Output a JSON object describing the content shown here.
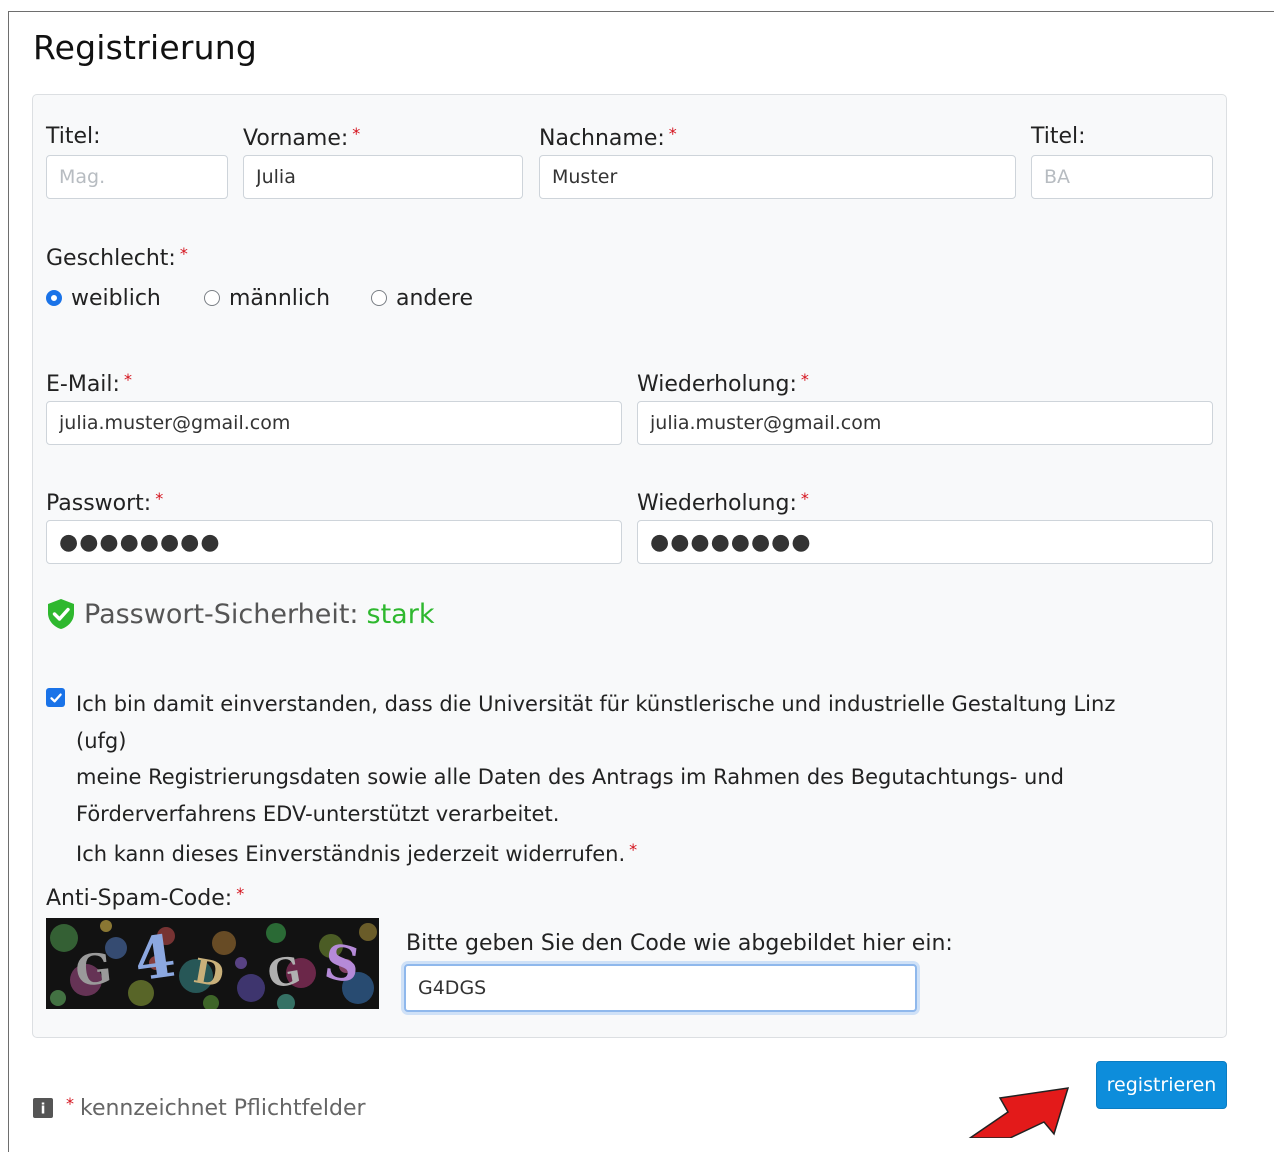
{
  "page": {
    "title": "Registrierung"
  },
  "required_mark": "*",
  "name_row": {
    "title_pre": {
      "label": "Titel:",
      "placeholder": "Mag."
    },
    "first_name": {
      "label": "Vorname:",
      "value": "Julia"
    },
    "last_name": {
      "label": "Nachname:",
      "value": "Muster"
    },
    "title_post": {
      "label": "Titel:",
      "placeholder": "BA"
    }
  },
  "gender": {
    "label": "Geschlecht:",
    "options": [
      "weiblich",
      "männlich",
      "andere"
    ],
    "selected": "weiblich"
  },
  "email": {
    "label": "E-Mail:",
    "value": "julia.muster@gmail.com",
    "repeat_label": "Wiederholung:",
    "repeat_value": "julia.muster@gmail.com"
  },
  "password": {
    "label": "Passwort:",
    "value": "●●●●●●●●",
    "repeat_label": "Wiederholung:",
    "repeat_value": "●●●●●●●●"
  },
  "strength": {
    "label": "Passwort-Sicherheit:",
    "value": "stark",
    "color": "#2eb82e"
  },
  "consent": {
    "checked": true,
    "line1": "Ich bin damit einverstanden, dass die Universität für künstlerische und industrielle Gestaltung Linz (ufg)",
    "line2": "meine Registrierungsdaten sowie alle Daten des Antrags im Rahmen des Begutachtungs- und",
    "line3": "Förderverfahrens EDV-unterstützt verarbeitet.",
    "line4": "Ich kann dieses Einverständnis jederzeit widerrufen."
  },
  "captcha": {
    "label": "Anti-Spam-Code:",
    "letters": [
      "G",
      "4",
      "D",
      "G",
      "S"
    ],
    "prompt": "Bitte geben Sie den Code wie abgebildet hier ein:",
    "value": "G4DGS"
  },
  "submit": {
    "label": "registrieren",
    "color": "#0d8ddb"
  },
  "footer": {
    "note": "kennzeichnet Pflichtfelder",
    "icon_glyph": "i"
  },
  "colors": {
    "accent": "#1a73e8",
    "required": "#d4111b",
    "arrow": "#e31a1a"
  }
}
